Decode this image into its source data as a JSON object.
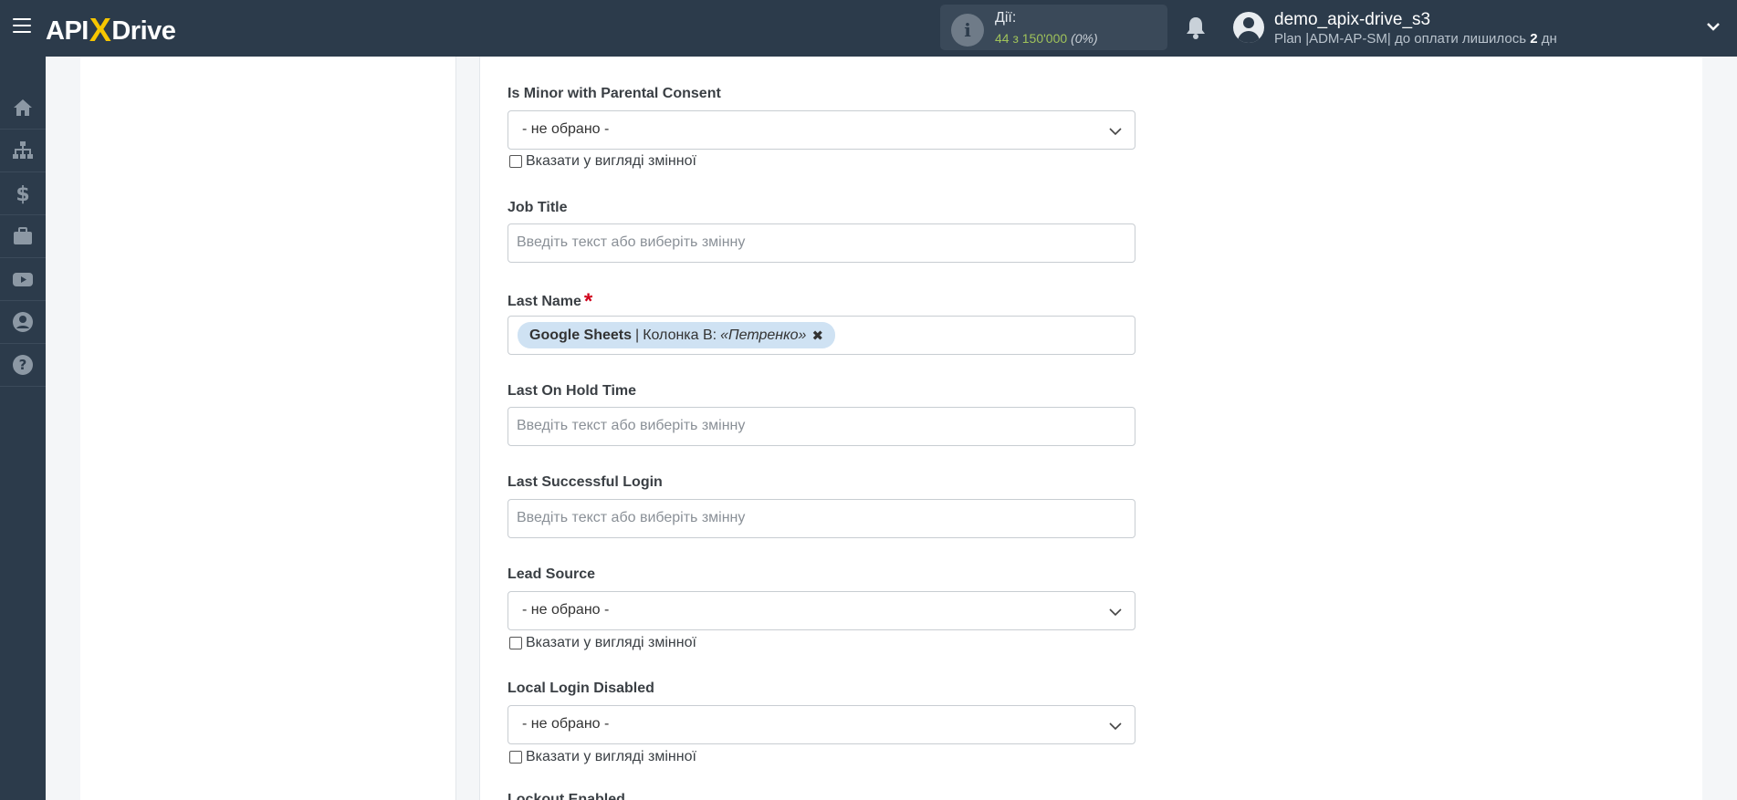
{
  "topbar": {
    "logo": {
      "left": "API",
      "x": "X",
      "right": "Drive"
    },
    "actions_label": "Дії:",
    "actions_count": "44 з 150'000",
    "actions_pct": "(0%)",
    "username": "demo_apix-drive_s3",
    "plan_prefix": "Plan |ADM-AP-SM| до оплати лишилось ",
    "plan_days": "2",
    "plan_suffix": " дн"
  },
  "sidebar": {
    "items": [
      "home-icon",
      "sitemap-icon",
      "dollar-icon",
      "briefcase-icon",
      "youtube-icon",
      "user-circle-icon",
      "help-icon"
    ]
  },
  "form": {
    "fields": [
      {
        "label": "Is Minor with Parental Consent",
        "type": "select",
        "value": "- не обрано -",
        "checkbox": "Вказати у вигляді змінної"
      },
      {
        "label": "Job Title",
        "type": "input",
        "placeholder": "Введіть текст або виберіть змінну"
      },
      {
        "label": "Last Name",
        "required": "*",
        "type": "tag",
        "tag_source": "Google Sheets",
        "tag_sep": "|",
        "tag_column": "Колонка B:",
        "tag_value": "«Петренко»"
      },
      {
        "label": "Last On Hold Time",
        "type": "input",
        "placeholder": "Введіть текст або виберіть змінну"
      },
      {
        "label": "Last Successful Login",
        "type": "input",
        "placeholder": "Введіть текст або виберіть змінну"
      },
      {
        "label": "Lead Source",
        "type": "select",
        "value": "- не обрано -",
        "checkbox": "Вказати у вигляді змінної"
      },
      {
        "label": "Local Login Disabled",
        "type": "select",
        "value": "- не обрано -",
        "checkbox": "Вказати у вигляді змінної"
      },
      {
        "label": "Lockout Enabled",
        "type": "partial"
      }
    ]
  },
  "colors": {
    "topbar": "#2c3b4b",
    "accent": "#f7c600",
    "count_green": "#9fc25a",
    "required": "#d0021b",
    "tag_bg": "#cfe2f3"
  }
}
